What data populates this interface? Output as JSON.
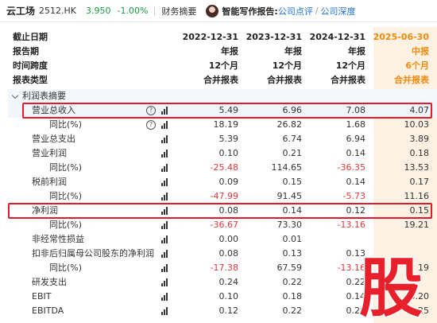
{
  "topbar": {
    "company": "云工场",
    "code": "2512.HK",
    "price": "3.950",
    "change": "-1.00%",
    "tab_financial": "财务摘要",
    "ai_label": "智能写作报告:",
    "link_review": "公司点评",
    "link_sep": "/",
    "link_depth": "公司深度"
  },
  "header_rows": [
    {
      "label": "截止日期",
      "values": [
        "2022-12-31",
        "2023-12-31",
        "2024-12-31",
        "2025-06-30"
      ]
    },
    {
      "label": "报告期",
      "values": [
        "年报",
        "年报",
        "年报",
        "中报"
      ]
    },
    {
      "label": "时间跨度",
      "values": [
        "12个月",
        "12个月",
        "12个月",
        "6个月"
      ]
    },
    {
      "label": "报表类型",
      "values": [
        "合并报表",
        "合并报表",
        "合并报表",
        "合并报表"
      ]
    }
  ],
  "section": {
    "label": "利润表摘要"
  },
  "rows": [
    {
      "label": "营业总收入",
      "values": [
        "5.49",
        "6.96",
        "7.08",
        "4.07"
      ]
    },
    {
      "label": "同比(%)",
      "values": [
        "18.19",
        "26.82",
        "1.68",
        "10.03"
      ]
    },
    {
      "label": "营业总支出",
      "values": [
        "5.39",
        "6.74",
        "6.94",
        "3.89"
      ]
    },
    {
      "label": "营业利润",
      "values": [
        "0.10",
        "0.21",
        "0.14",
        "0.18"
      ]
    },
    {
      "label": "同比(%)",
      "values": [
        "-25.48",
        "114.65",
        "-36.35",
        "13.53"
      ]
    },
    {
      "label": "税前利润",
      "values": [
        "0.09",
        "0.15",
        "0.14",
        "0.17"
      ]
    },
    {
      "label": "同比(%)",
      "values": [
        "-47.99",
        "91.45",
        "-5.73",
        "11.16"
      ]
    },
    {
      "label": "净利润",
      "values": [
        "0.08",
        "0.14",
        "0.12",
        "0.15"
      ]
    },
    {
      "label": "同比(%)",
      "values": [
        "-36.67",
        "73.30",
        "-13.16",
        "19.21"
      ]
    },
    {
      "label": "非经常性损益",
      "values": [
        "0.00",
        "0.01",
        "",
        ""
      ]
    },
    {
      "label": "扣非后归属母公司股东的净利润",
      "values": [
        "0.08",
        "0.13",
        "0.13",
        ""
      ]
    },
    {
      "label": "同比(%)",
      "values": [
        "-17.38",
        "67.59",
        "-13.16",
        "19"
      ]
    },
    {
      "label": "研发支出",
      "values": [
        "0.24",
        "0.22",
        "0.22",
        ""
      ]
    },
    {
      "label": "EBIT",
      "values": [
        "0.10",
        "0.18",
        "0.14",
        "0.20"
      ]
    },
    {
      "label": "EBITDA",
      "values": [
        "0.12",
        "0.22",
        "0.29",
        "0.25"
      ]
    }
  ],
  "watermark_char": "股",
  "colors": {
    "negative": "#e03a3a",
    "highlight_box": "#e4192b",
    "latest_period": "#f08a0c",
    "link": "#1e6fd9",
    "price_down": "#1a9c3e"
  }
}
